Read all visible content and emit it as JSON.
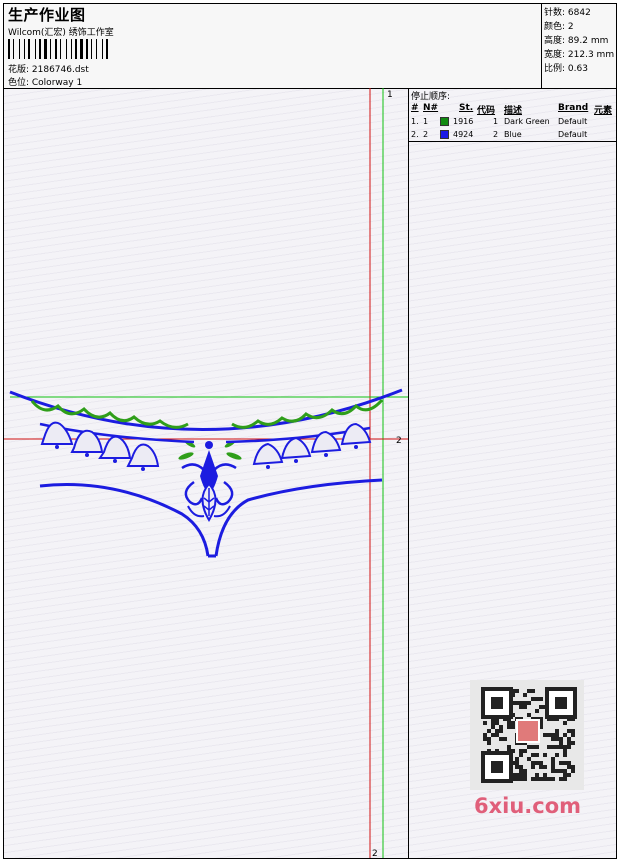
{
  "header": {
    "title": "生产作业图",
    "company": "Wilcom(汇宏) 绣饰工作室",
    "design_label": "花版: 2186746.dst",
    "colorway_label": "色位: Colorway 1"
  },
  "stats": [
    {
      "label": "针数",
      "value": "6842"
    },
    {
      "label": "颜色",
      "value": "2"
    },
    {
      "label": "高度",
      "value": "89.2 mm"
    },
    {
      "label": "宽度",
      "value": "212.3 mm"
    },
    {
      "label": "比例",
      "value": "0.63"
    }
  ],
  "stop_sequence": {
    "title": "停止顺序:",
    "headers": {
      "num": "#",
      "n": "N#",
      "st": "St.",
      "code": "代码",
      "desc": "描述",
      "brand": "Brand",
      "element": "元素"
    },
    "rows": [
      {
        "num": "1.",
        "n": "1",
        "st": "1916",
        "code": "1",
        "desc": "Dark Green",
        "brand": "Default",
        "color": "#118a11"
      },
      {
        "num": "2.",
        "n": "2",
        "st": "4924",
        "code": "2",
        "desc": "Blue",
        "brand": "Default",
        "color": "#1a1ae6"
      }
    ]
  },
  "guides": {
    "v1_label": "1",
    "h2_label": "2",
    "v2_label": "2"
  },
  "colors": {
    "green": "#2f9e1a",
    "blue": "#1c1ce0",
    "guide_red": "#d01010",
    "guide_green": "#10c010"
  },
  "watermark": {
    "text": "6xiu.com"
  }
}
